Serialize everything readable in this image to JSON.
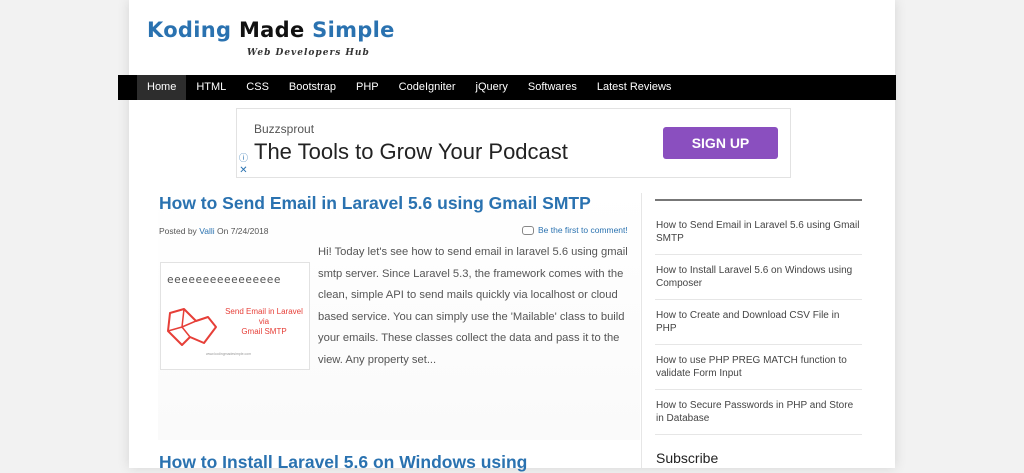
{
  "header": {
    "logo_word1": "Koding",
    "logo_word2": "Made",
    "logo_word3": "Simple",
    "tagline": "Web Developers Hub"
  },
  "nav": {
    "items": [
      "Home",
      "HTML",
      "CSS",
      "Bootstrap",
      "PHP",
      "CodeIgniter",
      "jQuery",
      "Softwares",
      "Latest Reviews"
    ],
    "active": "Home"
  },
  "ad": {
    "brand": "Buzzsprout",
    "headline": "The Tools to Grow Your Podcast",
    "cta": "SIGN UP",
    "info_glyph": "ⓘ",
    "close_glyph": "✕"
  },
  "post": {
    "title": "How to Send Email in Laravel 5.6 using Gmail SMTP",
    "meta_posted_by": "Posted by",
    "author": "Valli",
    "meta_on": "On",
    "date": "7/24/2018",
    "comments": "Be the first to comment!",
    "thumb_rings": "eeeeeeeeeeeeeeee",
    "thumb_line1": "Send Email in Laravel",
    "thumb_line2": "via",
    "thumb_line3": "Gmail SMTP",
    "thumb_url": "www.kodingmadesimple.com",
    "excerpt": "Hi! Today let's see how to send email in laravel 5.6 using gmail smtp server. Since Laravel 5.3, the framework comes with the clean, simple API to send mails quickly via localhost or cloud based service. You can simply use the 'Mailable' class to build your emails. These classes collect the data and pass it to the view. Any property set..."
  },
  "post2": {
    "title": "How to Install Laravel 5.6 on Windows using"
  },
  "sidebar": {
    "recent_posts": [
      "How to Send Email in Laravel 5.6 using Gmail SMTP",
      "How to Install Laravel 5.6 on Windows using Composer",
      "How to Create and Download CSV File in PHP",
      "How to use PHP PREG MATCH function to validate Form Input",
      "How to Secure Passwords in PHP and Store in Database"
    ],
    "subscribe_title": "Subscribe"
  },
  "colors": {
    "brand_blue": "#2a72b0",
    "nav_bg": "#000000",
    "cta_purple": "#8a4fbf"
  }
}
